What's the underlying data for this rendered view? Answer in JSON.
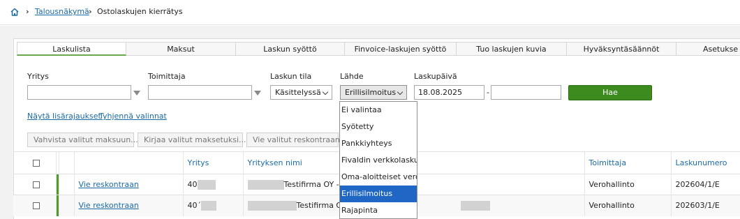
{
  "breadcrumb": {
    "home_icon": "home-icon",
    "items": [
      "Talousnäkymä",
      "Ostolaskujen kierrätys"
    ],
    "link_color": "#1a6aa6"
  },
  "tabs": [
    "Laskulista",
    "Maksut",
    "Laskun syöttö",
    "Finvoice-laskujen syöttö",
    "Tuo laskujen kuvia",
    "Hyväksyntäsäännöt",
    "Asetukse"
  ],
  "active_tab": "Laskulista",
  "filters": {
    "yritys_label": "Yritys",
    "yritys_value": "",
    "toimittaja_label": "Toimittaja",
    "toimittaja_value": "",
    "laskun_tila_label": "Laskun tila",
    "laskun_tila_value": "Käsittelyssä",
    "lahde_label": "Lähde",
    "lahde_value": "Erillisilmoitus",
    "laskupaiva_label": "Laskupäivä",
    "laskupaiva_from": "18.08.2025",
    "laskupaiva_to": "",
    "range_dash": "-",
    "search_button": "Hae",
    "search_button_color": "#3d8b1f"
  },
  "links": {
    "more_filters": "Näytä lisärajaukset",
    "clear": "Tyhjennä valinnat"
  },
  "actions": [
    "Vahvista valitut maksuun...",
    "Kirjaa valitut maksetuksi...",
    "Vie valitut reskontraan"
  ],
  "table": {
    "headers": [
      "Yritys",
      "Yrityksen nimi",
      "Toimittaja",
      "Laskunumero"
    ],
    "rows": [
      {
        "action": "Vie reskontraan",
        "yritys": "40",
        "nimi": "Testifirma OY - I",
        "toimittaja": "Verohallinto",
        "laskunumero": "202604/1/E"
      },
      {
        "action": "Vie reskontraan",
        "yritys": "40´",
        "nimi": "Testifirma O",
        "toimittaja": "Verohallinto",
        "laskunumero": "202603/1/E"
      }
    ]
  },
  "source_dropdown": {
    "options": [
      "Ei valintaa",
      "Syötetty",
      "Pankkiyhteys",
      "Fivaldin verkkolasku",
      "Oma-aloitteiset verot",
      "Erillisilmoitus",
      "Rajapinta"
    ],
    "selected": "Erillisilmoitus",
    "highlight_color": "#1f66c5"
  }
}
